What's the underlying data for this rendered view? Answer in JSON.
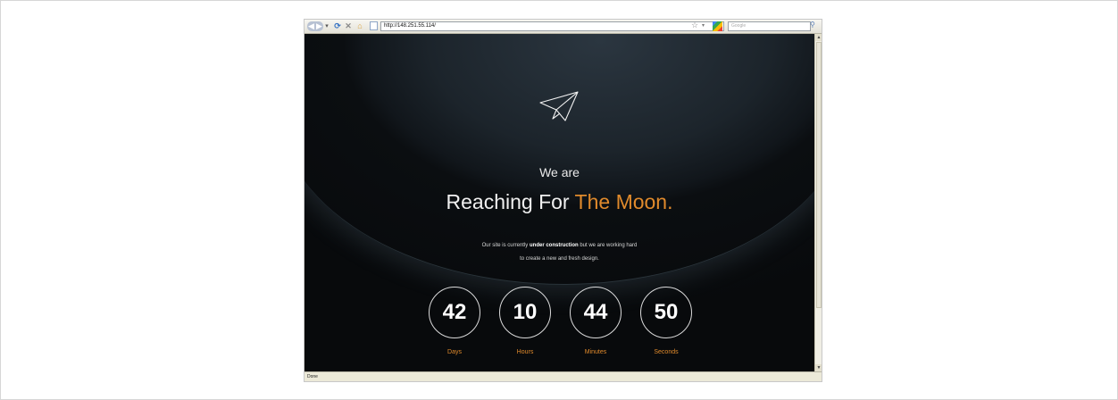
{
  "browser": {
    "url": "http://148.251.55.114/",
    "search_placeholder": "Google",
    "status": "Done"
  },
  "page": {
    "intro": "We are",
    "headline_main": "Reaching For ",
    "headline_highlight": "The Moon.",
    "desc_line1_a": "Our site is currently ",
    "desc_line1_b": "under construction",
    "desc_line1_c": " but we are working hard",
    "desc_line2": "to create a new and fresh design.",
    "accent_color": "#e08a2c",
    "countdown": [
      {
        "value": "42",
        "label": "Days"
      },
      {
        "value": "10",
        "label": "Hours"
      },
      {
        "value": "44",
        "label": "Minutes"
      },
      {
        "value": "50",
        "label": "Seconds"
      }
    ]
  },
  "icons": {
    "logo": "paper-plane-icon",
    "back": "back-arrow-icon",
    "forward": "forward-arrow-icon",
    "reload": "reload-icon",
    "stop": "stop-icon",
    "home": "home-icon",
    "bookmark": "star-icon",
    "search_engine": "google-icon",
    "search": "magnifier-icon"
  }
}
